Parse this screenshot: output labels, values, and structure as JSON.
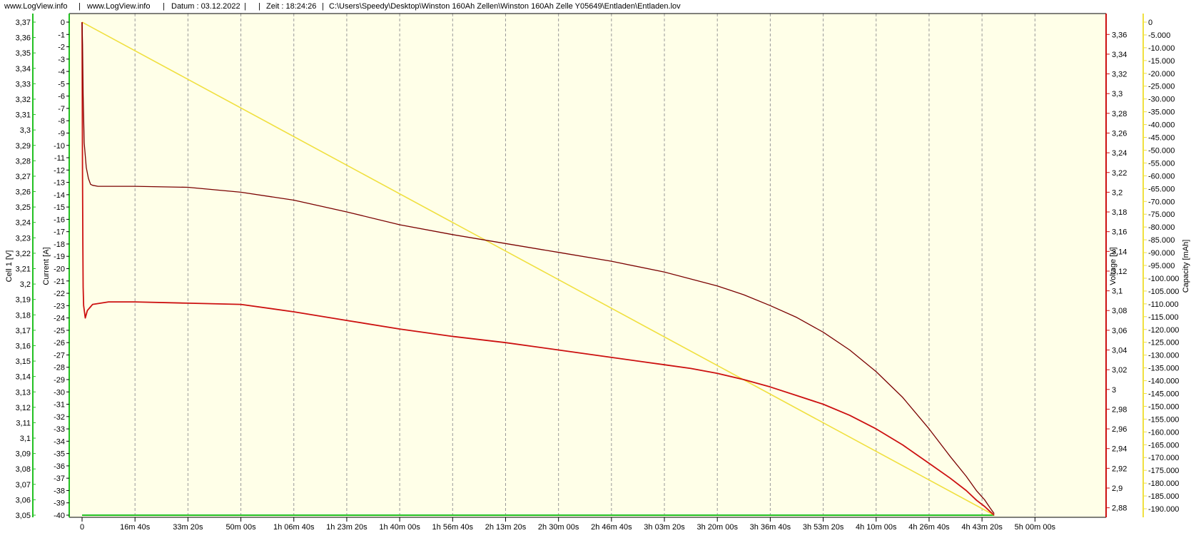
{
  "header": {
    "site1": "www.LogView.info",
    "site2": "www.LogView.info",
    "date": "Datum : 03.12.2022",
    "time": "Zeit : 18:24:26",
    "path": "C:\\Users\\Speedy\\Desktop\\Winston 160Ah Zellen\\Winston 160Ah Zelle Y05649\\Entladen\\Entladen.lov"
  },
  "colors": {
    "plot_background": "#ffffe8",
    "cell_voltage": "#7a0000",
    "current": "#cc1010",
    "voltage": "#cc1010",
    "capacity": "#f0e040",
    "cell_axis_line": "#22c022",
    "grid": "#999999"
  },
  "chart_data": {
    "type": "line",
    "x_unit": "time",
    "xlim_seconds": [
      0,
      18400
    ],
    "x_ticks": [
      {
        "label": "0",
        "sec": 0
      },
      {
        "label": "16m 40s",
        "sec": 1000
      },
      {
        "label": "33m 20s",
        "sec": 2000
      },
      {
        "label": "50m 00s",
        "sec": 3000
      },
      {
        "label": "1h 06m 40s",
        "sec": 4000
      },
      {
        "label": "1h 23m 20s",
        "sec": 5000
      },
      {
        "label": "1h 40m 00s",
        "sec": 6000
      },
      {
        "label": "1h 56m 40s",
        "sec": 7000
      },
      {
        "label": "2h 13m 20s",
        "sec": 8000
      },
      {
        "label": "2h 30m 00s",
        "sec": 9000
      },
      {
        "label": "2h 46m 40s",
        "sec": 10000
      },
      {
        "label": "3h 03m 20s",
        "sec": 11000
      },
      {
        "label": "3h 20m 00s",
        "sec": 12000
      },
      {
        "label": "3h 36m 40s",
        "sec": 13000
      },
      {
        "label": "3h 53m 20s",
        "sec": 14000
      },
      {
        "label": "4h 10m 00s",
        "sec": 15000
      },
      {
        "label": "4h 26m 40s",
        "sec": 16000
      },
      {
        "label": "4h 43m 20s",
        "sec": 17000
      },
      {
        "label": "5h 00m 00s",
        "sec": 18000
      }
    ],
    "axes": {
      "cell": {
        "label": "Cell 1 [V]",
        "ylim": [
          3.05,
          3.37
        ],
        "ticks": [
          "3,37",
          "3,36",
          "3,35",
          "3,34",
          "3,33",
          "3,32",
          "3,31",
          "3,3",
          "3,29",
          "3,28",
          "3,27",
          "3,26",
          "3,25",
          "3,24",
          "3,23",
          "3,22",
          "3,21",
          "3,2",
          "3,19",
          "3,18",
          "3,17",
          "3,16",
          "3,15",
          "3,14",
          "3,13",
          "3,12",
          "3,11",
          "3,1",
          "3,09",
          "3,08",
          "3,07",
          "3,06",
          "3,05"
        ]
      },
      "current": {
        "label": "Current [A]",
        "ylim": [
          -40,
          0
        ],
        "ticks": [
          "0",
          "-1",
          "-2",
          "-3",
          "-4",
          "-5",
          "-6",
          "-7",
          "-8",
          "-9",
          "-10",
          "-11",
          "-12",
          "-13",
          "-14",
          "-15",
          "-16",
          "-17",
          "-18",
          "-19",
          "-20",
          "-21",
          "-22",
          "-23",
          "-24",
          "-25",
          "-26",
          "-27",
          "-28",
          "-29",
          "-30",
          "-31",
          "-32",
          "-33",
          "-34",
          "-35",
          "-36",
          "-37",
          "-38",
          "-39",
          "-40"
        ]
      },
      "voltage": {
        "label": "Voltage [V]",
        "ylim": [
          2.8725,
          3.3725
        ],
        "ticks": [
          "3,36",
          "3,34",
          "3,32",
          "3,3",
          "3,28",
          "3,26",
          "3,24",
          "3,22",
          "3,2",
          "3,18",
          "3,16",
          "3,14",
          "3,12",
          "3,1",
          "3,08",
          "3,06",
          "3,04",
          "3,02",
          "3",
          "2,98",
          "2,96",
          "2,94",
          "2,92",
          "2,9",
          "2,88"
        ],
        "tick_values": [
          3.36,
          3.34,
          3.32,
          3.3,
          3.28,
          3.26,
          3.24,
          3.22,
          3.2,
          3.18,
          3.16,
          3.14,
          3.12,
          3.1,
          3.08,
          3.06,
          3.04,
          3.02,
          3.0,
          2.98,
          2.96,
          2.94,
          2.92,
          2.9,
          2.88
        ]
      },
      "capacity": {
        "label": "Capacity [mAh]",
        "ylim": [
          -192500,
          0
        ],
        "ticks": [
          "0",
          "-5.000",
          "-10.000",
          "-15.000",
          "-20.000",
          "-25.000",
          "-30.000",
          "-35.000",
          "-40.000",
          "-45.000",
          "-50.000",
          "-55.000",
          "-60.000",
          "-65.000",
          "-70.000",
          "-75.000",
          "-80.000",
          "-85.000",
          "-90.000",
          "-95.000",
          "-100.000",
          "-105.000",
          "-110.000",
          "-115.000",
          "-120.000",
          "-125.000",
          "-130.000",
          "-135.000",
          "-140.000",
          "-145.000",
          "-150.000",
          "-155.000",
          "-160.000",
          "-165.000",
          "-170.000",
          "-175.000",
          "-180.000",
          "-185.000",
          "-190.000"
        ]
      }
    },
    "series": [
      {
        "name": "Cell 1",
        "axis": "voltage",
        "x": [
          0,
          10,
          20,
          40,
          80,
          120,
          160,
          200,
          300,
          500,
          1000,
          2000,
          3000,
          4000,
          5000,
          6000,
          7000,
          8000,
          9000,
          10000,
          11000,
          12000,
          12500,
          13000,
          13500,
          14000,
          14500,
          15000,
          15500,
          16000,
          16400,
          16700,
          16900,
          17050,
          17150,
          17230
        ],
        "y": [
          3.372,
          3.35,
          3.3,
          3.25,
          3.225,
          3.214,
          3.208,
          3.207,
          3.206,
          3.206,
          3.206,
          3.205,
          3.2,
          3.192,
          3.18,
          3.167,
          3.157,
          3.148,
          3.139,
          3.13,
          3.119,
          3.105,
          3.096,
          3.085,
          3.073,
          3.058,
          3.04,
          3.018,
          2.992,
          2.96,
          2.932,
          2.912,
          2.897,
          2.888,
          2.88,
          2.874
        ]
      },
      {
        "name": "Current",
        "axis": "current",
        "x": [
          0,
          8,
          15,
          20,
          30,
          60,
          100,
          200,
          500,
          1000,
          2000,
          3000,
          4000,
          5000,
          6000,
          7000,
          8000,
          9000,
          10000,
          11000,
          11500,
          12000,
          12500,
          13000,
          13500,
          14000,
          14500,
          15000,
          15500,
          16000,
          16400,
          16700,
          16900,
          17050,
          17150,
          17230
        ],
        "y": [
          0,
          -12,
          -18,
          -21.5,
          -23,
          -24,
          -23.4,
          -22.9,
          -22.7,
          -22.7,
          -22.8,
          -22.9,
          -23.5,
          -24.2,
          -24.9,
          -25.5,
          -26.0,
          -26.6,
          -27.2,
          -27.8,
          -28.1,
          -28.5,
          -29.0,
          -29.6,
          -30.3,
          -31.0,
          -31.9,
          -33.0,
          -34.3,
          -35.8,
          -37.0,
          -38.0,
          -38.8,
          -39.3,
          -39.7,
          -40.0
        ]
      },
      {
        "name": "Capacity",
        "axis": "capacity",
        "x": [
          0,
          17230
        ],
        "y": [
          0,
          -192500
        ]
      },
      {
        "name": "Cell 1 baseline",
        "axis": "cell",
        "x": [
          0,
          17230
        ],
        "y": [
          3.05,
          3.05
        ]
      }
    ]
  }
}
